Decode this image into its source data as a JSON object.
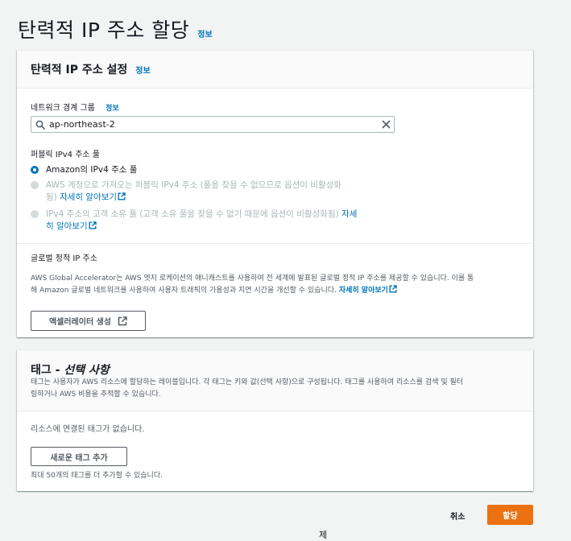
{
  "page": {
    "title": "탄력적 IP 주소 할당",
    "info": "정보"
  },
  "settings": {
    "title": "탄력적 IP 주소 설정",
    "info": "정보",
    "network_border_group_label": "네트워크 경계 그룹",
    "network_border_group_info": "정보",
    "network_border_group_value": "ap-northeast-2",
    "pool_label": "퍼블릭 IPv4 주소 풀",
    "options": [
      {
        "text": "Amazon의 IPv4 주소 풀",
        "checked": true,
        "disabled": false
      },
      {
        "text": "AWS 계정으로 가져오는 퍼블릭 IPv4 주소 (풀을 찾을 수 없으므로 옵션이 비활성화",
        "text2": "됨)",
        "link": "자세히 알아보기",
        "checked": false,
        "disabled": true
      },
      {
        "text": "IPv4 주소의 고객 소유 풀 (고객 소유 풀을 찾을 수 없기 때문에 옵션이 비활성화됨)",
        "link_a": "자세",
        "link_b": "히 알아보기",
        "checked": false,
        "disabled": true
      }
    ],
    "global_static_label": "글로벌 정적 IP 주소",
    "global_desc_line1": "AWS Global Accelerator는 AWS 엣지 로케이션의 애니캐스트를 사용하여 전 세계에 발표된 글로벌 정적 IP 주소를 제공할 수 있습니다. 이를 통",
    "global_desc_line2": "해 Amazon 글로벌 네트워크를 사용하여 사용자 트래픽의 가용성과 지연 시간을 개선할 수 있습니다.",
    "global_desc_link": "자세히 알아보기",
    "create_accelerator_button": "액셀러레이터 생성"
  },
  "tags": {
    "title_prefix": "태그 - ",
    "title_optional": "선택 사항",
    "desc_line1": "태그는 사용자가 AWS 리소스에 할당하는 레이블입니다. 각 태그는 키와 값(선택 사항)으로 구성됩니다. 태그를 사용하여 리소스를 검색 및 필터",
    "desc_line2": "링하거나 AWS 비용을 추적할 수 있습니다.",
    "empty_text": "리소스에 연결된 태그가 없습니다.",
    "add_tag_button": "새로운 태그 추가",
    "limit_text": "최대 50개의 태그를 더 추가할 수 있습니다."
  },
  "footer": {
    "cancel": "취소",
    "submit": "할당",
    "cursor_text": "제"
  },
  "colors": {
    "accent": "#0073bb",
    "primary_button": "#ec7211"
  }
}
